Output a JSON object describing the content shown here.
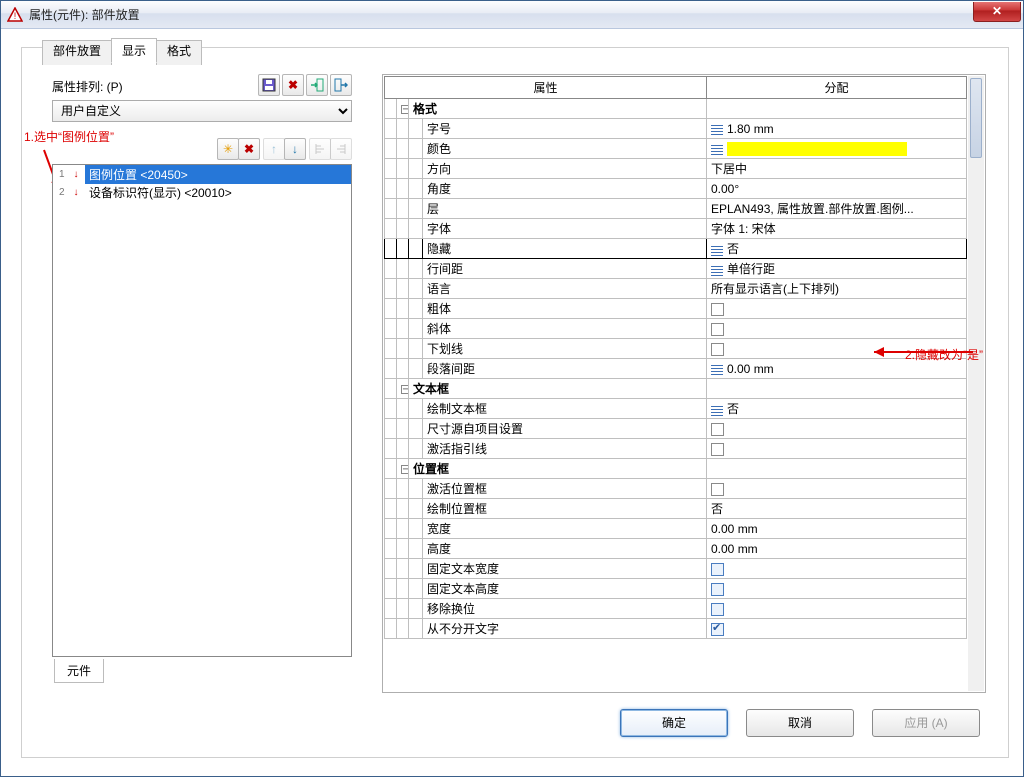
{
  "window": {
    "title": "属性(元件): 部件放置"
  },
  "tabs": {
    "main": [
      "部件放置",
      "显示",
      "格式"
    ],
    "bottom": "元件"
  },
  "leftpane": {
    "label": "属性排列: (P)",
    "combo_value": "用户自定义",
    "list": [
      {
        "text": "图例位置 <20450>",
        "selected": true
      },
      {
        "text": "设备标识符(显示) <20010>",
        "selected": false
      }
    ]
  },
  "annotations": {
    "a1": "1.选中“图例位置”",
    "a2": "2.隐藏改为“是”"
  },
  "prop_headers": {
    "name": "属性",
    "value": "分配"
  },
  "groups": {
    "g1": "格式",
    "g2": "文本框",
    "g3": "位置框",
    "r_fontsize": "字号",
    "v_fontsize": "1.80 mm",
    "r_color": "颜色",
    "r_dir": "方向",
    "v_dir": "下居中",
    "r_angle": "角度",
    "v_angle": "0.00°",
    "r_layer": "层",
    "v_layer": "EPLAN493, 属性放置.部件放置.图例...",
    "r_font": "字体",
    "v_font": "字体 1: 宋体",
    "r_hide": "隐藏",
    "v_hide": "否",
    "r_linesp": "行间距",
    "v_linesp": "单倍行距",
    "r_lang": "语言",
    "v_lang": "所有显示语言(上下排列)",
    "r_bold": "粗体",
    "r_italic": "斜体",
    "r_under": "下划线",
    "r_paraspace": "段落间距",
    "v_paraspace": "0.00 mm",
    "r_drawtb": "绘制文本框",
    "v_drawtb": "否",
    "r_sizeproj": "尺寸源自项目设置",
    "r_actguide": "激活指引线",
    "r_actpos": "激活位置框",
    "r_drawpos": "绘制位置框",
    "v_drawpos": "否",
    "r_width": "宽度",
    "v_width": "0.00 mm",
    "r_height": "高度",
    "v_height": "0.00 mm",
    "r_fixw": "固定文本宽度",
    "r_fixh": "固定文本高度",
    "r_shift": "移除换位",
    "r_nobreak": "从不分开文字"
  },
  "buttons": {
    "ok": "确定",
    "cancel": "取消",
    "apply": "应用 (A)"
  }
}
